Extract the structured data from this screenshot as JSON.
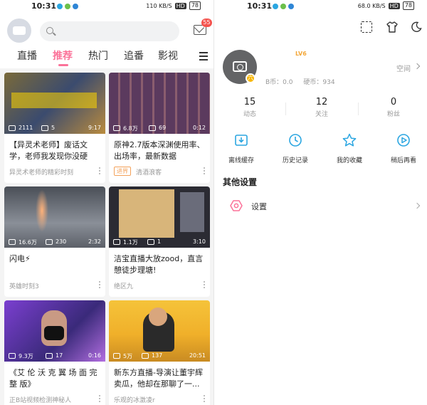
{
  "left": {
    "status": {
      "time": "10:31",
      "net_speed": "110 KB/S",
      "hd": "HD",
      "battery": "78"
    },
    "header": {
      "mail_badge": "55"
    },
    "tabs": [
      {
        "label": "直播",
        "active": false
      },
      {
        "label": "推荐",
        "active": true
      },
      {
        "label": "热门",
        "active": false
      },
      {
        "label": "追番",
        "active": false
      },
      {
        "label": "影视",
        "active": false
      }
    ],
    "videos": [
      {
        "views": "2111",
        "danmaku": "5",
        "duration": "9:17",
        "title": "【异灵术老师】废话文学，老师我发现你没硬币...",
        "uploader": "异灵术老师的精彩时刻",
        "tag": ""
      },
      {
        "views": "6.8万",
        "danmaku": "69",
        "duration": "0:12",
        "title": "原神2.7版本深渊使用率、出场率，最新数据",
        "uploader": "清酒浪客",
        "tag": "进界"
      },
      {
        "views": "16.6万",
        "danmaku": "230",
        "duration": "2:32",
        "title": "闪电⚡",
        "uploader": "英雄时刻3",
        "tag": ""
      },
      {
        "views": "1.1万",
        "danmaku": "1",
        "duration": "3:10",
        "title": "洁宝直播大放zood，直言憩徒步理塘!",
        "uploader": "绝区九",
        "tag": ""
      },
      {
        "views": "9.3万",
        "danmaku": "17",
        "duration": "0:16",
        "title": "《艾 伦 沃 克 翼 场 面 完 整 版》",
        "uploader": "正B站视频检测神秘人",
        "tag": ""
      },
      {
        "views": "5万",
        "danmaku": "137",
        "duration": "20:51",
        "title": "新东方直播-导演让董宇辉卖瓜，他却在那聊了一...",
        "uploader": "乐观的冰激凌r",
        "tag": ""
      }
    ]
  },
  "right": {
    "status": {
      "time": "10:31",
      "net_speed": "68.0 KB/S",
      "hd": "HD",
      "battery": "78"
    },
    "profile": {
      "level_dot": "六",
      "level_badge": "LV6",
      "bcoin": "B币：0.0",
      "coin": "硬币：934",
      "space_label": "空间"
    },
    "stats": [
      {
        "num": "15",
        "label": "动态"
      },
      {
        "num": "12",
        "label": "关注"
      },
      {
        "num": "0",
        "label": "粉丝"
      }
    ],
    "actions": [
      {
        "label": "离线缓存",
        "icon": "download-icon"
      },
      {
        "label": "历史记录",
        "icon": "history-icon"
      },
      {
        "label": "我的收藏",
        "icon": "star-icon"
      },
      {
        "label": "稍后再看",
        "icon": "watch-later-icon"
      }
    ],
    "section_title": "其他设置",
    "settings_label": "设置"
  },
  "colors": {
    "accent": "#fb7299",
    "action_blue": "#2ba6e1",
    "gold": "#f3a738"
  }
}
